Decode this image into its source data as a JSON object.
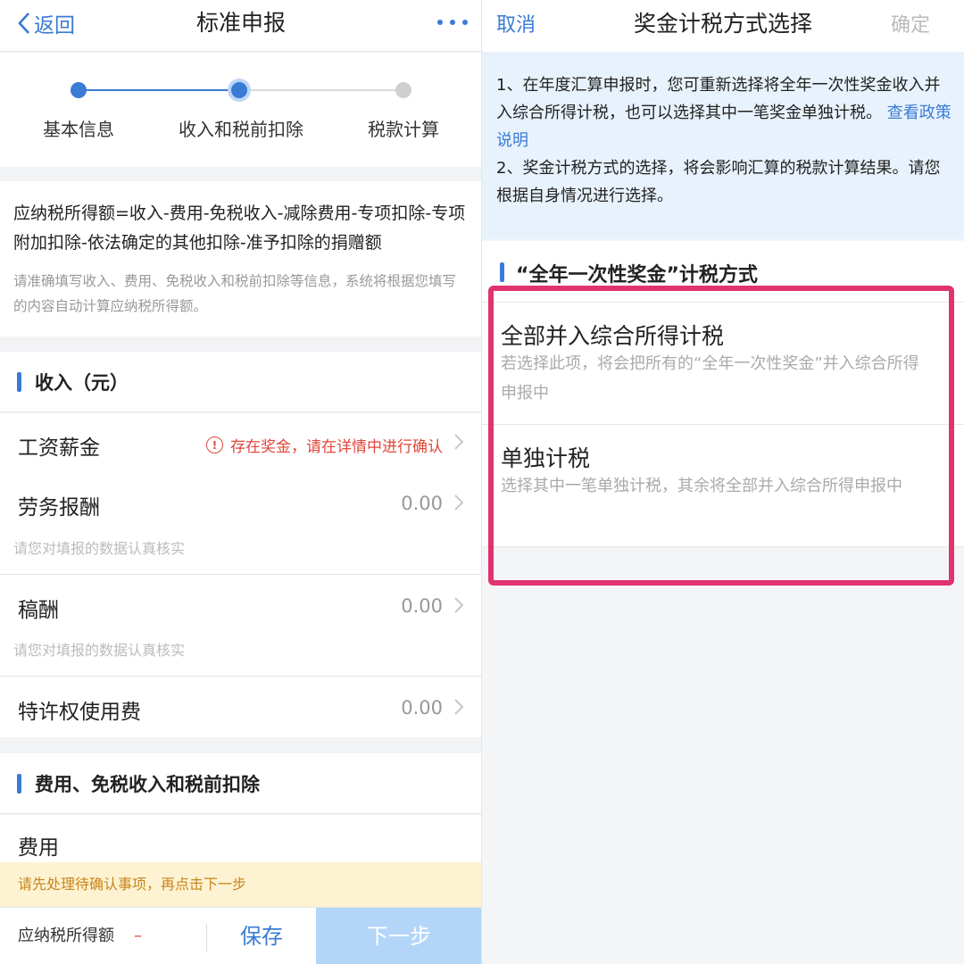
{
  "left": {
    "nav": {
      "back_label": "返回",
      "title": "标准申报"
    },
    "steps": [
      {
        "label": "基本信息",
        "state": "done"
      },
      {
        "label": "收入和税前扣除",
        "state": "current"
      },
      {
        "label": "税款计算",
        "state": "pending"
      }
    ],
    "formula": {
      "main": "应纳税所得额=收入-费用-免税收入-减除费用-专项扣除-专项附加扣除-依法确定的其他扣除-准予扣除的捐赠额",
      "hint": "请准确填写收入、费用、免税收入和税前扣除等信息，系统将根据您填写的内容自动计算应纳税所得额。"
    },
    "income_section": {
      "title": "收入（元）",
      "rows": [
        {
          "label": "工资薪金",
          "warning": "存在奖金，请在详情中进行确认"
        },
        {
          "label": "劳务报酬",
          "value": "0.00",
          "hint": "请您对填报的数据认真核实"
        },
        {
          "label": "稿酬",
          "value": "0.00",
          "hint": "请您对填报的数据认真核实"
        },
        {
          "label": "特许权使用费",
          "value": "0.00"
        }
      ]
    },
    "deduction_section": {
      "title": "费用、免税收入和税前扣除",
      "rows": [
        {
          "label": "费用"
        }
      ]
    },
    "notice": "请先处理待确认事项，再点击下一步",
    "bottom": {
      "tax_label": "应纳税所得额",
      "tax_value": "–",
      "save_label": "保存",
      "next_label": "下一步"
    }
  },
  "right": {
    "nav": {
      "cancel_label": "取消",
      "title": "奖金计税方式选择",
      "confirm_label": "确定"
    },
    "info": {
      "line1": "1、在年度汇算申报时，您可重新选择将全年一次性奖金收入并入综合所得计税，也可以选择其中一笔奖金单独计税。",
      "link": "查看政策说明",
      "line2": "2、奖金计税方式的选择，将会影响汇算的税款计算结果。请您根据自身情况进行选择。"
    },
    "section_title": "“全年一次性奖金”计税方式",
    "options": [
      {
        "title": "全部并入综合所得计税",
        "desc": "若选择此项，将会把所有的“全年一次性奖金”并入综合所得申报中"
      },
      {
        "title": "单独计税",
        "desc": "选择其中一笔单独计税，其余将全部并入综合所得申报中"
      }
    ]
  },
  "colors": {
    "accent": "#3a7bd5",
    "warning": "#e0463a",
    "highlight": "#e0336f",
    "notice_bg": "#fdf3d2",
    "next_disabled": "#b3d6f8"
  }
}
